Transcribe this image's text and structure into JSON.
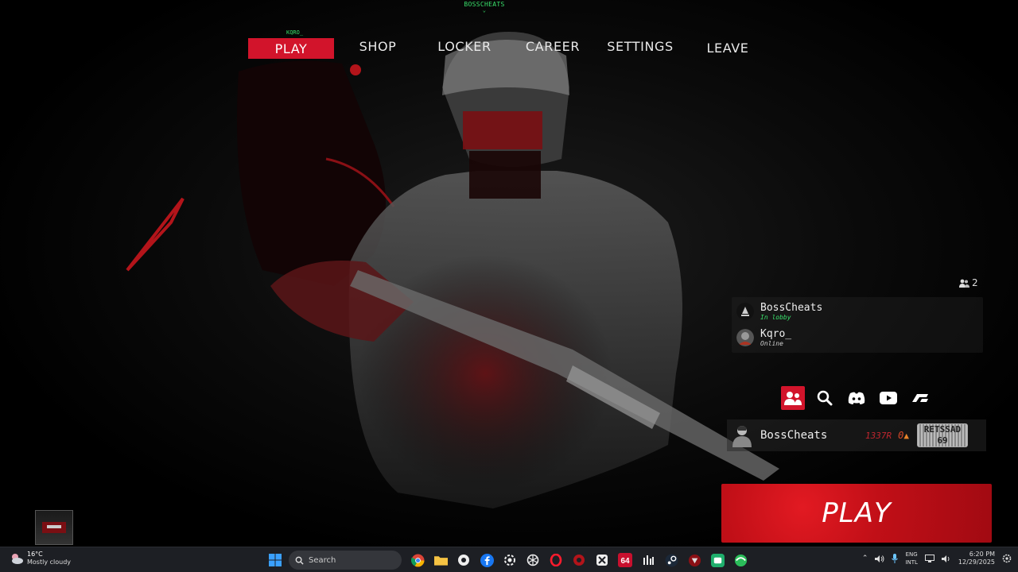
{
  "app": {
    "top_tag": "BOSSCHEATS",
    "top_chevron": "⌄",
    "nav_user": "KQRO_",
    "nav": [
      {
        "label": "PLAY",
        "active": true
      },
      {
        "label": "SHOP"
      },
      {
        "label": "LOCKER"
      },
      {
        "label": "CAREER"
      },
      {
        "label": "SETTINGS"
      },
      {
        "label": "LEAVE"
      }
    ],
    "accent_color": "#d2142b",
    "online_color": "#39e06b"
  },
  "party": {
    "count": "2",
    "members": [
      {
        "name": "BossCheats",
        "status": "In lobby",
        "status_color": "#39e06b"
      },
      {
        "name": "Kqro_",
        "status": "Online",
        "status_color": "#cfcfcf"
      }
    ]
  },
  "social": {
    "icons": [
      "friends-icon",
      "search-icon",
      "discord-icon",
      "youtube-icon",
      "link-icon"
    ]
  },
  "profile": {
    "name": "BossCheats",
    "reputation": "1337R",
    "streak": "0",
    "badge_line1": "RETSSAD",
    "badge_line2": "69"
  },
  "play_button": {
    "label": "PLAY"
  },
  "taskbar": {
    "weather_temp": "16°C",
    "weather_desc": "Mostly cloudy",
    "search_placeholder": "Search",
    "lang_1": "ENG",
    "lang_2": "INTL",
    "time": "6:20 PM",
    "date": "12/29/2025"
  }
}
